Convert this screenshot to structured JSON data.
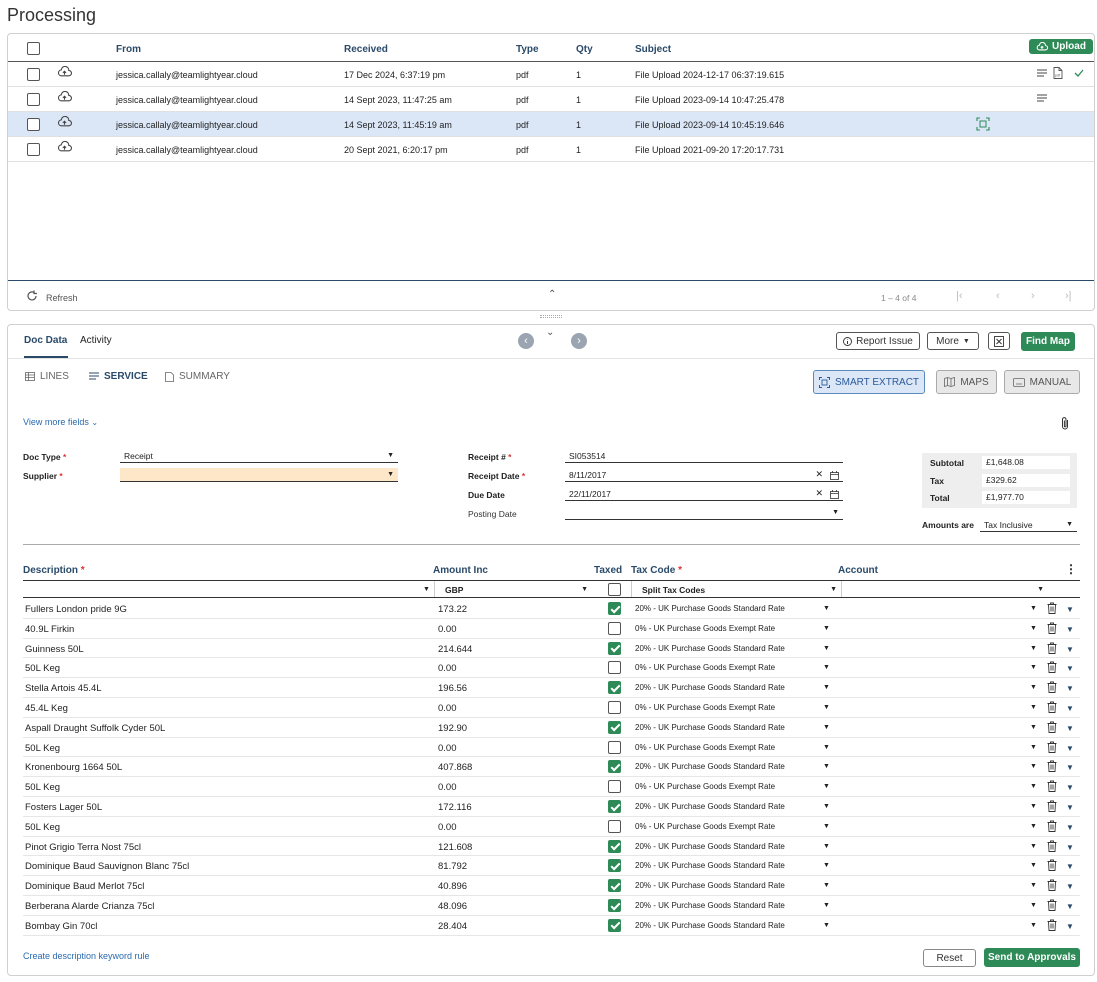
{
  "page_title": "Processing",
  "inbox": {
    "headers": {
      "from": "From",
      "received": "Received",
      "type": "Type",
      "qty": "Qty",
      "subject": "Subject"
    },
    "upload_label": "Upload",
    "rows": [
      {
        "from": "jessica.callaly@teamlightyear.cloud",
        "received": "17 Dec 2024, 6:37:19 pm",
        "type": "pdf",
        "qty": "1",
        "subject": "File Upload 2024-12-17 06:37:19.615"
      },
      {
        "from": "jessica.callaly@teamlightyear.cloud",
        "received": "14 Sept 2023, 11:47:25 am",
        "type": "pdf",
        "qty": "1",
        "subject": "File Upload 2023-09-14 10:47:25.478"
      },
      {
        "from": "jessica.callaly@teamlightyear.cloud",
        "received": "14 Sept 2023, 11:45:19 am",
        "type": "pdf",
        "qty": "1",
        "subject": "File Upload 2023-09-14 10:45:19.646"
      },
      {
        "from": "jessica.callaly@teamlightyear.cloud",
        "received": "20 Sept 2021, 6:20:17 pm",
        "type": "pdf",
        "qty": "1",
        "subject": "File Upload 2021-09-20 17:20:17.731"
      }
    ],
    "refresh_label": "Refresh",
    "pagination": "1 – 4 of 4"
  },
  "doc": {
    "tabs": [
      "Doc Data",
      "Activity"
    ],
    "report_issue": "Report Issue",
    "more": "More",
    "find_map": "Find Map",
    "subtabs": {
      "lines": "LINES",
      "service": "SERVICE",
      "summary": "SUMMARY"
    },
    "smart_extract": "SMART EXTRACT",
    "maps": "MAPS",
    "manual": "MANUAL",
    "view_more": "View more fields",
    "doc_type_label": "Doc Type",
    "doc_type_value": "Receipt",
    "supplier_label": "Supplier",
    "supplier_value": "",
    "receipt_no_label": "Receipt #",
    "receipt_no_value": "SI053514",
    "receipt_date_label": "Receipt Date",
    "receipt_date_value": "8/11/2017",
    "due_date_label": "Due Date",
    "due_date_value": "22/11/2017",
    "posting_date_label": "Posting Date",
    "posting_date_value": "",
    "subtotal_label": "Subtotal",
    "subtotal_value": "£1,648.08",
    "tax_label": "Tax",
    "tax_value": "£329.62",
    "total_label": "Total",
    "total_value": "£1,977.70",
    "amounts_are_label": "Amounts are",
    "amounts_are_value": "Tax Inclusive"
  },
  "lines": {
    "headers": {
      "description": "Description",
      "amount": "Amount Inc",
      "taxed": "Taxed",
      "tax_code": "Tax Code",
      "account": "Account"
    },
    "filters": {
      "currency": "GBP",
      "tax_code": "Split Tax Codes"
    },
    "rows": [
      {
        "description": "Fullers London pride 9G",
        "amount": "173.22",
        "taxed": true,
        "tax_code": "20% - UK Purchase Goods Standard Rate"
      },
      {
        "description": "40.9L Firkin",
        "amount": "0.00",
        "taxed": false,
        "tax_code": "0% - UK Purchase Goods Exempt Rate"
      },
      {
        "description": "Guinness 50L",
        "amount": "214.644",
        "taxed": true,
        "tax_code": "20% - UK Purchase Goods Standard Rate"
      },
      {
        "description": "50L Keg",
        "amount": "0.00",
        "taxed": false,
        "tax_code": "0% - UK Purchase Goods Exempt Rate"
      },
      {
        "description": "Stella Artois 45.4L",
        "amount": "196.56",
        "taxed": true,
        "tax_code": "20% - UK Purchase Goods Standard Rate"
      },
      {
        "description": "45.4L Keg",
        "amount": "0.00",
        "taxed": false,
        "tax_code": "0% - UK Purchase Goods Exempt Rate"
      },
      {
        "description": "Aspall Draught Suffolk Cyder 50L",
        "amount": "192.90",
        "taxed": true,
        "tax_code": "20% - UK Purchase Goods Standard Rate"
      },
      {
        "description": "50L Keg",
        "amount": "0.00",
        "taxed": false,
        "tax_code": "0% - UK Purchase Goods Exempt Rate"
      },
      {
        "description": "Kronenbourg 1664 50L",
        "amount": "407.868",
        "taxed": true,
        "tax_code": "20% - UK Purchase Goods Standard Rate"
      },
      {
        "description": "50L Keg",
        "amount": "0.00",
        "taxed": false,
        "tax_code": "0% - UK Purchase Goods Exempt Rate"
      },
      {
        "description": "Fosters Lager 50L",
        "amount": "172.116",
        "taxed": true,
        "tax_code": "20% - UK Purchase Goods Standard Rate"
      },
      {
        "description": "50L Keg",
        "amount": "0.00",
        "taxed": false,
        "tax_code": "0% - UK Purchase Goods Exempt Rate"
      },
      {
        "description": "Pinot Grigio Terra Nost 75cl",
        "amount": "121.608",
        "taxed": true,
        "tax_code": "20% - UK Purchase Goods Standard Rate"
      },
      {
        "description": "Dominique Baud Sauvignon Blanc 75cl",
        "amount": "81.792",
        "taxed": true,
        "tax_code": "20% - UK Purchase Goods Standard Rate"
      },
      {
        "description": "Dominique Baud Merlot 75cl",
        "amount": "40.896",
        "taxed": true,
        "tax_code": "20% - UK Purchase Goods Standard Rate"
      },
      {
        "description": "Berberana Alarde Crianza 75cl",
        "amount": "48.096",
        "taxed": true,
        "tax_code": "20% - UK Purchase Goods Standard Rate"
      },
      {
        "description": "Bombay Gin 70cl",
        "amount": "28.404",
        "taxed": true,
        "tax_code": "20% - UK Purchase Goods Standard Rate"
      }
    ],
    "create_rule": "Create description keyword rule",
    "reset": "Reset",
    "send": "Send to Approvals"
  },
  "colors": {
    "accent_green": "#2e8b57",
    "header_blue": "#2a4a6a",
    "selected_row": "#dbe7f7"
  }
}
